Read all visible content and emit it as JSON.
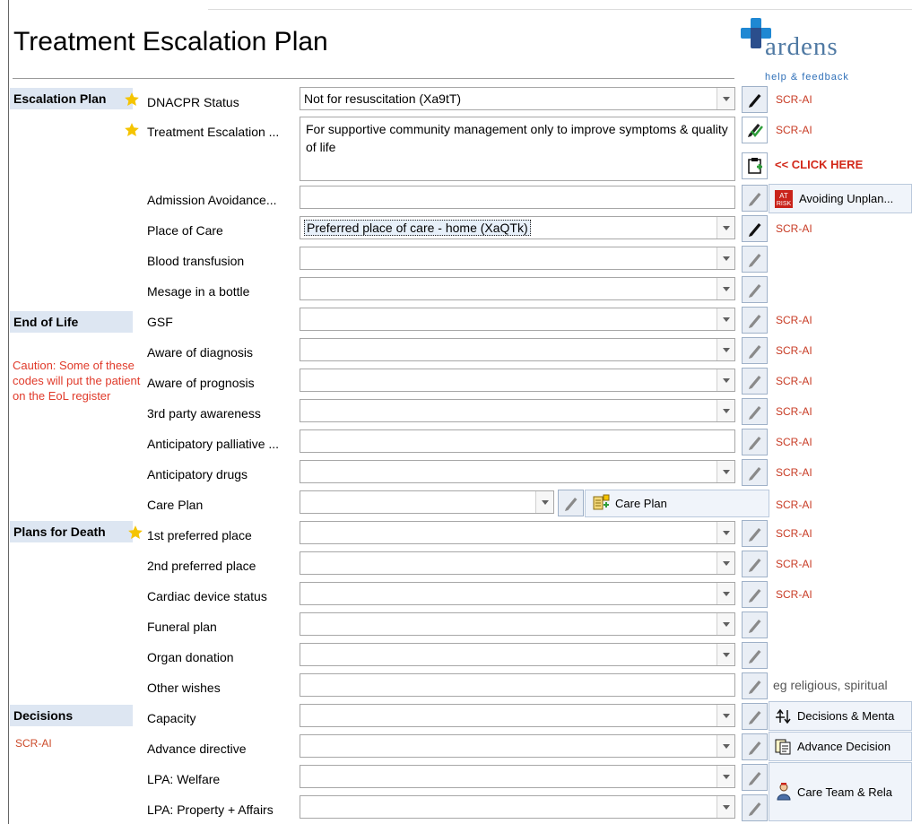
{
  "title": "Treatment Escalation Plan",
  "logo": {
    "text": "ardens",
    "help_link": "help & feedback",
    "colors": {
      "blue": "#1f88d3",
      "dark": "#2b4e8c"
    }
  },
  "sections": {
    "escalation": "Escalation Plan",
    "end_of_life": "End of Life",
    "plans_for_death": "Plans for Death",
    "decisions": "Decisions"
  },
  "caution": "Caution: Some of these codes will put the patient on the EoL register",
  "decisions_note": "SCR-AI",
  "fields": {
    "dnacpr": {
      "label": "DNACPR Status",
      "value": "Not for resuscitation (Xa9tT)",
      "tag": "SCR-AI"
    },
    "treatment_escalation": {
      "label": "Treatment Escalation ...",
      "value": "For supportive community management only to improve symptoms & quality of life",
      "tag": "SCR-AI"
    },
    "admission_avoidance": {
      "label": "Admission Avoidance...",
      "value": "",
      "action": "Avoiding Unplan..."
    },
    "place_of_care": {
      "label": "Place of Care",
      "value": "Preferred place of care - home (XaQTk)",
      "tag": "SCR-AI"
    },
    "blood_transfusion": {
      "label": "Blood transfusion",
      "value": ""
    },
    "message_bottle": {
      "label": "Mesage in a bottle",
      "value": ""
    },
    "gsf": {
      "label": "GSF",
      "value": "",
      "tag": "SCR-AI"
    },
    "aware_diagnosis": {
      "label": "Aware of diagnosis",
      "value": "",
      "tag": "SCR-AI"
    },
    "aware_prognosis": {
      "label": "Aware of prognosis",
      "value": "",
      "tag": "SCR-AI"
    },
    "third_party": {
      "label": "3rd party awareness",
      "value": "",
      "tag": "SCR-AI"
    },
    "anticipatory_palliative": {
      "label": "Anticipatory palliative ...",
      "value": "",
      "tag": "SCR-AI"
    },
    "anticipatory_drugs": {
      "label": "Anticipatory drugs",
      "value": "",
      "tag": "SCR-AI"
    },
    "care_plan": {
      "label": "Care Plan",
      "value": "",
      "button": "Care Plan",
      "tag": "SCR-AI"
    },
    "first_place": {
      "label": "1st preferred place",
      "value": "",
      "tag": "SCR-AI"
    },
    "second_place": {
      "label": "2nd preferred place",
      "value": "",
      "tag": "SCR-AI"
    },
    "cardiac_device": {
      "label": "Cardiac device status",
      "value": "",
      "tag": "SCR-AI"
    },
    "funeral_plan": {
      "label": "Funeral plan",
      "value": ""
    },
    "organ_donation": {
      "label": "Organ donation",
      "value": ""
    },
    "other_wishes": {
      "label": "Other wishes",
      "value": "",
      "hint": "eg religious, spiritual"
    },
    "capacity": {
      "label": "Capacity",
      "value": "",
      "action": "Decisions & Menta"
    },
    "advance_directive": {
      "label": "Advance directive",
      "value": "",
      "action": "Advance Decision"
    },
    "lpa_welfare": {
      "label": "LPA: Welfare",
      "value": ""
    },
    "lpa_property": {
      "label": "LPA: Property + Affairs",
      "value": ""
    },
    "care_team_action": "Care Team & Rela"
  },
  "click_here": "<< CLICK HERE",
  "icons": {
    "required": "star-icon",
    "edit": "pencil-icon",
    "accent": "#f5c400",
    "tag_color": "#c83b24"
  }
}
